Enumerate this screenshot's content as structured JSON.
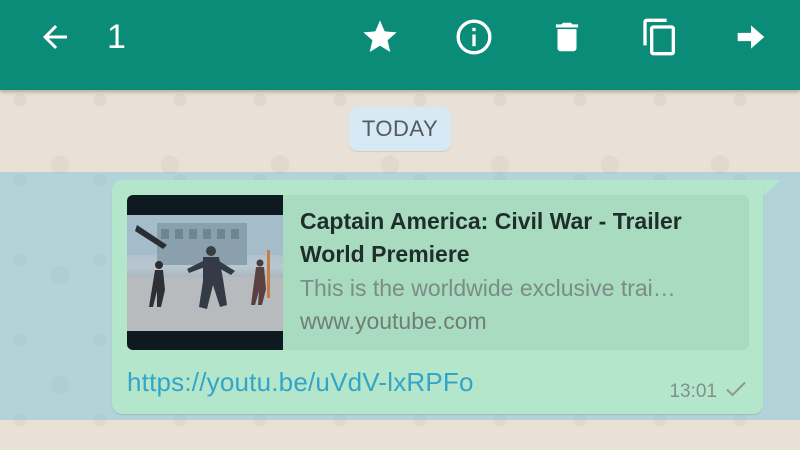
{
  "toolbar": {
    "back_icon": "arrow-left-icon",
    "selected_count": "1",
    "star_icon": "star-icon",
    "info_icon": "info-icon",
    "delete_icon": "trash-icon",
    "copy_icon": "copy-icon",
    "forward_icon": "forward-arrow-icon",
    "bar_color": "#0a8c78"
  },
  "chat": {
    "date_divider": "TODAY",
    "message": {
      "preview": {
        "title": "Captain America: Civil War - Trailer World Premiere",
        "description": "This is the worldwide exclusive trai…",
        "domain": "www.youtube.com"
      },
      "link": "https://youtu.be/uVdV-lxRPFo",
      "time": "13:01",
      "status_icon": "check-icon",
      "bubble_color": "#b4e6cb"
    }
  }
}
